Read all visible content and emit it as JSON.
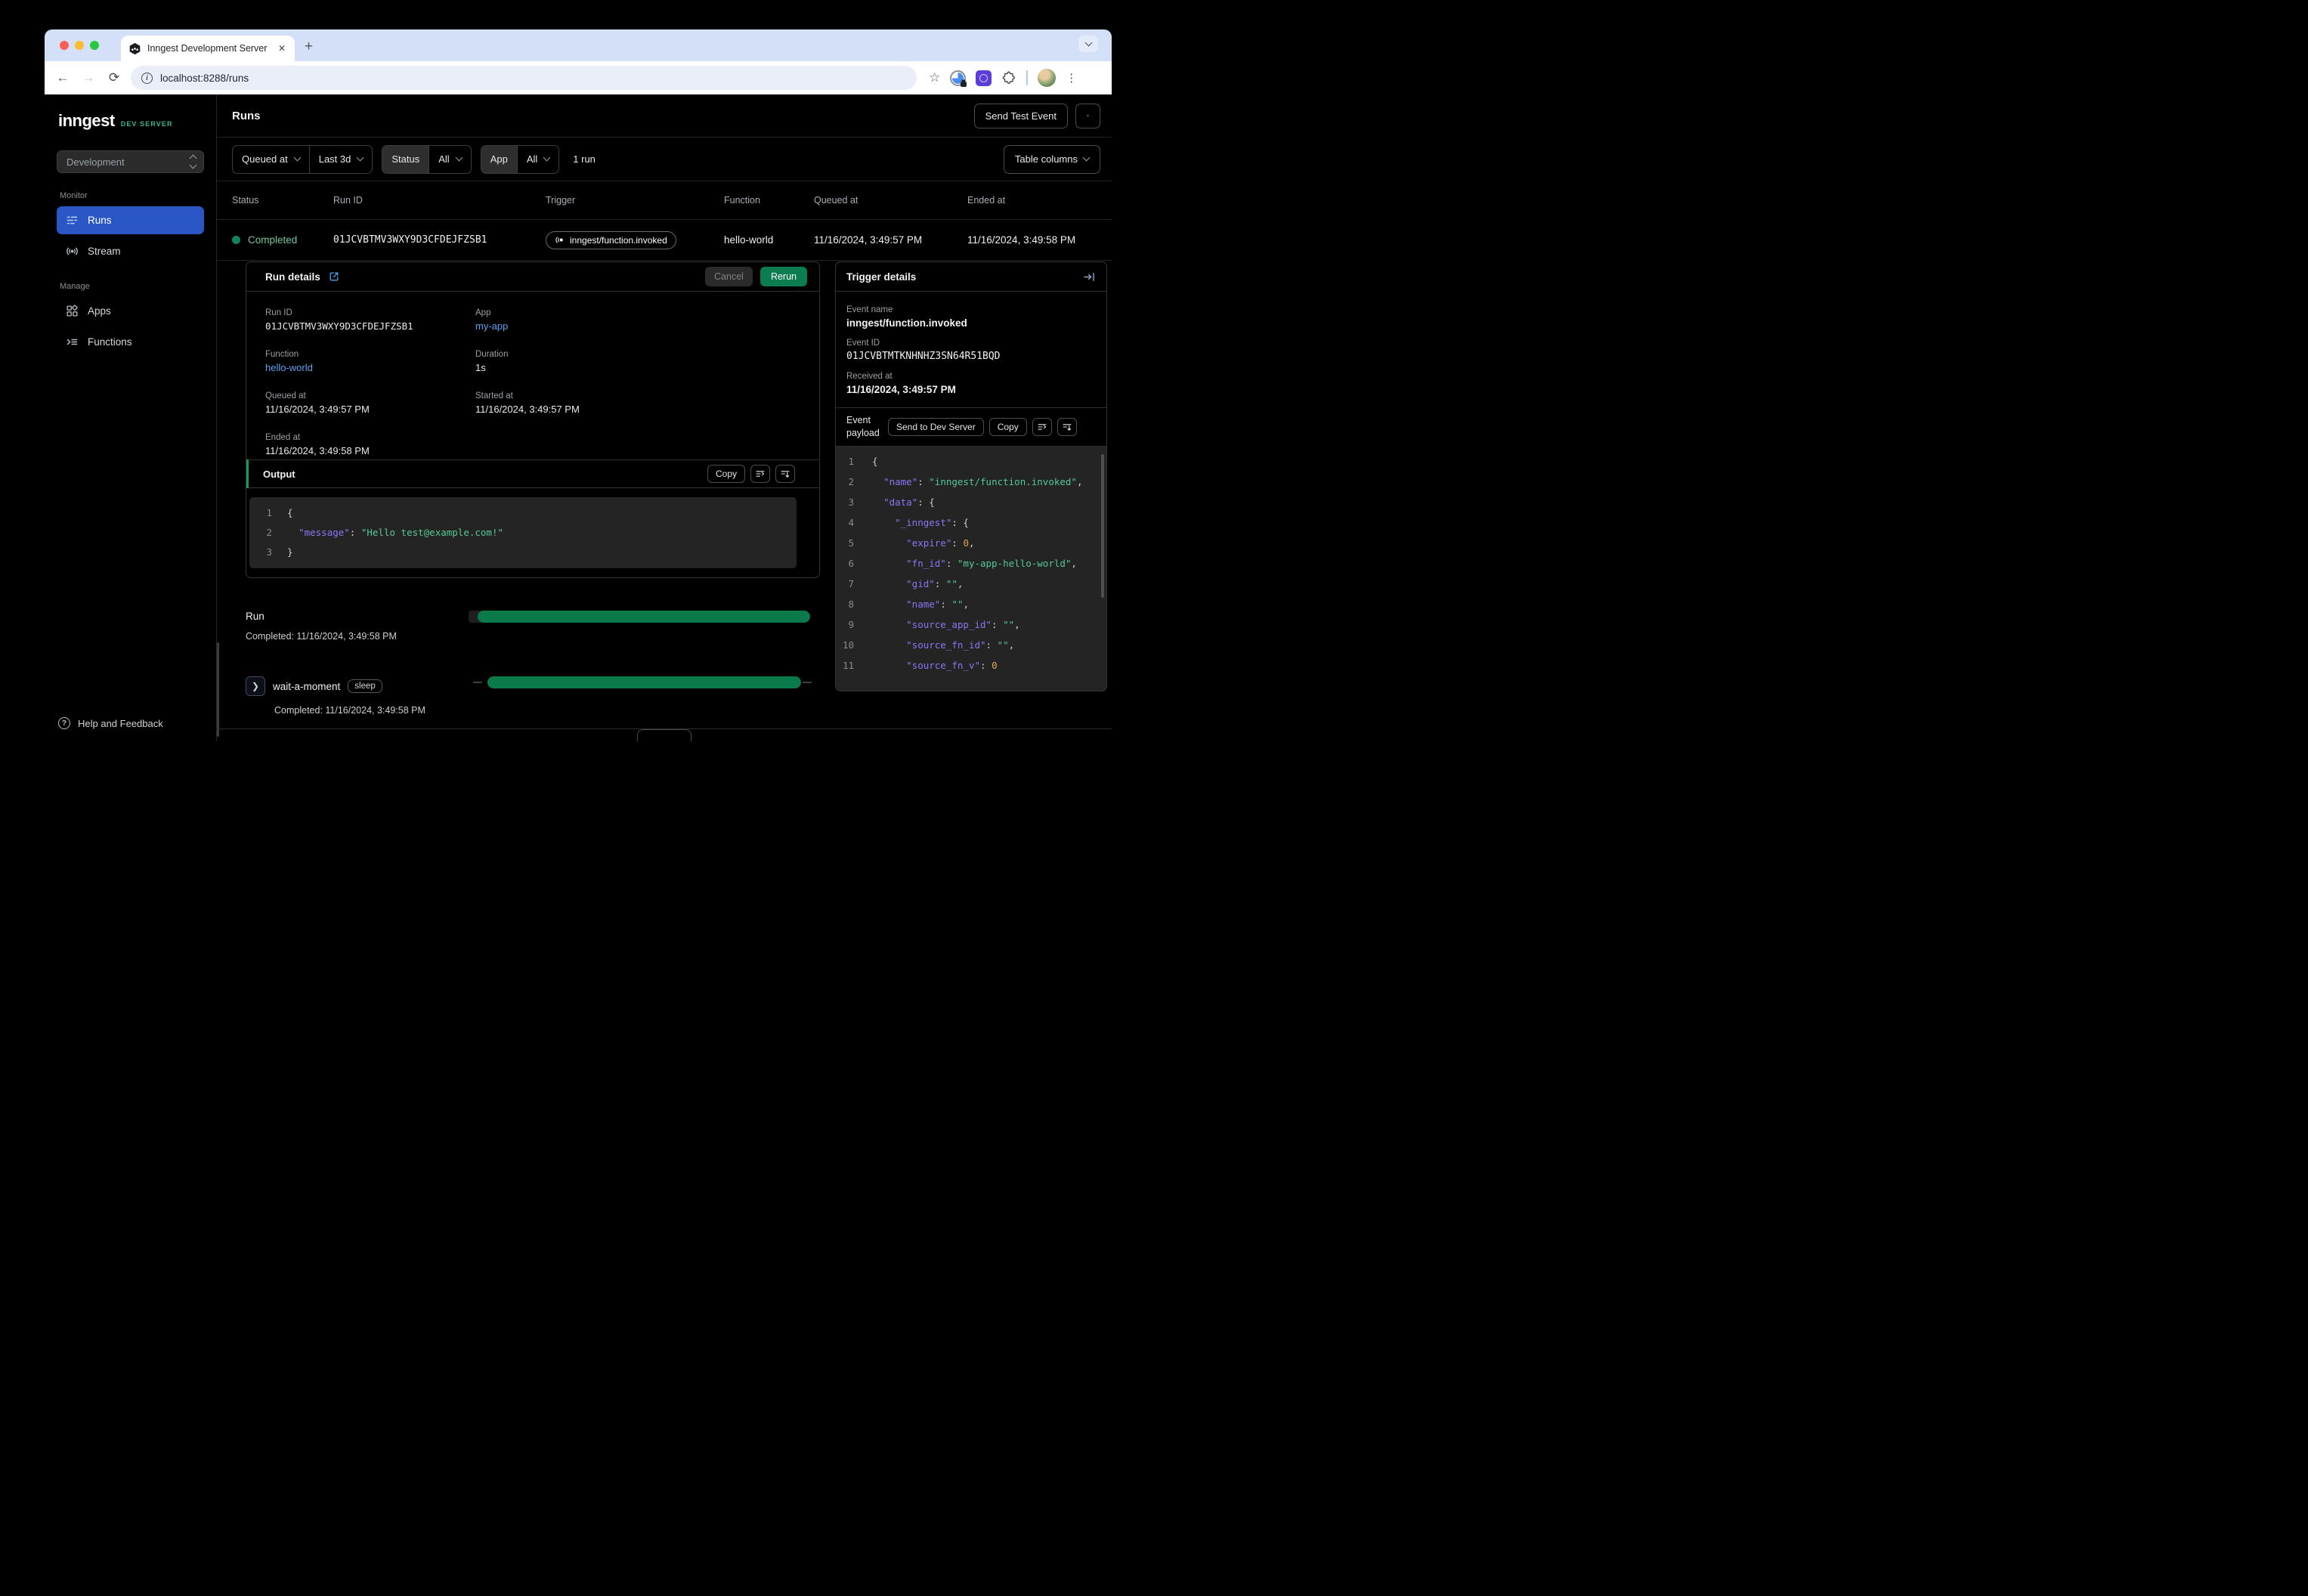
{
  "browser": {
    "tab_title": "Inngest Development Server",
    "url": "localhost:8288/runs"
  },
  "sidebar": {
    "logo": "inngest",
    "logo_badge": "DEV SERVER",
    "env_select": "Development",
    "sections": [
      {
        "label": "Monitor",
        "items": [
          {
            "label": "Runs"
          },
          {
            "label": "Stream"
          }
        ]
      },
      {
        "label": "Manage",
        "items": [
          {
            "label": "Apps"
          },
          {
            "label": "Functions"
          }
        ]
      }
    ],
    "help": "Help and Feedback"
  },
  "header": {
    "title": "Runs",
    "send_test_event": "Send Test Event"
  },
  "filters": {
    "time_field": "Queued at",
    "time_range": "Last 3d",
    "status_label": "Status",
    "status_value": "All",
    "app_label": "App",
    "app_value": "All",
    "run_count": "1 run",
    "table_columns": "Table columns"
  },
  "table": {
    "columns": [
      "Status",
      "Run ID",
      "Trigger",
      "Function",
      "Queued at",
      "Ended at"
    ],
    "row": {
      "status": "Completed",
      "run_id": "01JCVBTMV3WXY9D3CFDEJFZSB1",
      "trigger": "inngest/function.invoked",
      "function": "hello-world",
      "queued_at": "11/16/2024, 3:49:57 PM",
      "ended_at": "11/16/2024, 3:49:58 PM"
    }
  },
  "run_details": {
    "title": "Run details",
    "cancel": "Cancel",
    "rerun": "Rerun",
    "run_id_label": "Run ID",
    "run_id": "01JCVBTMV3WXY9D3CFDEJFZSB1",
    "app_label": "App",
    "app": "my-app",
    "function_label": "Function",
    "function": "hello-world",
    "duration_label": "Duration",
    "duration": "1s",
    "queued_label": "Queued at",
    "queued": "11/16/2024, 3:49:57 PM",
    "started_label": "Started at",
    "started": "11/16/2024, 3:49:57 PM",
    "ended_label": "Ended at",
    "ended": "11/16/2024, 3:49:58 PM",
    "output_title": "Output",
    "copy": "Copy"
  },
  "timeline": {
    "run_label": "Run",
    "run_completed": "Completed: 11/16/2024, 3:49:58 PM",
    "step_name": "wait-a-moment",
    "step_kind": "sleep",
    "step_completed": "Completed: 11/16/2024, 3:49:58 PM"
  },
  "trigger_details": {
    "title": "Trigger details",
    "event_name_label": "Event name",
    "event_name": "inngest/function.invoked",
    "event_id_label": "Event ID",
    "event_id": "01JCVBTMTKNHNHZ3SN64R51BQD",
    "received_label": "Received at",
    "received": "11/16/2024, 3:49:57 PM",
    "payload_label": "Event payload",
    "send_to_dev_server": "Send to Dev Server",
    "copy": "Copy"
  },
  "code": {
    "output": [
      {
        "n": "1",
        "t": [
          [
            "p",
            "{"
          ]
        ]
      },
      {
        "n": "2",
        "t": [
          [
            "p",
            "  "
          ],
          [
            "k",
            "\"message\""
          ],
          [
            "p",
            ": "
          ],
          [
            "s",
            "\"Hello test@example.com!\""
          ]
        ]
      },
      {
        "n": "3",
        "t": [
          [
            "p",
            "}"
          ]
        ]
      }
    ],
    "payload": [
      {
        "n": "1",
        "t": [
          [
            "p",
            "{"
          ]
        ]
      },
      {
        "n": "2",
        "t": [
          [
            "p",
            "  "
          ],
          [
            "k",
            "\"name\""
          ],
          [
            "p",
            ": "
          ],
          [
            "s",
            "\"inngest/function.invoked\""
          ],
          [
            "p",
            ","
          ]
        ]
      },
      {
        "n": "3",
        "t": [
          [
            "p",
            "  "
          ],
          [
            "k",
            "\"data\""
          ],
          [
            "p",
            ": {"
          ]
        ]
      },
      {
        "n": "4",
        "t": [
          [
            "p",
            "    "
          ],
          [
            "k",
            "\"_inngest\""
          ],
          [
            "p",
            ": {"
          ]
        ]
      },
      {
        "n": "5",
        "t": [
          [
            "p",
            "      "
          ],
          [
            "k",
            "\"expire\""
          ],
          [
            "p",
            ": "
          ],
          [
            "n2",
            "0"
          ],
          [
            "p",
            ","
          ]
        ]
      },
      {
        "n": "6",
        "t": [
          [
            "p",
            "      "
          ],
          [
            "k",
            "\"fn_id\""
          ],
          [
            "p",
            ": "
          ],
          [
            "s",
            "\"my-app-hello-world\""
          ],
          [
            "p",
            ","
          ]
        ]
      },
      {
        "n": "7",
        "t": [
          [
            "p",
            "      "
          ],
          [
            "k",
            "\"gid\""
          ],
          [
            "p",
            ": "
          ],
          [
            "s",
            "\"\""
          ],
          [
            "p",
            ","
          ]
        ]
      },
      {
        "n": "8",
        "t": [
          [
            "p",
            "      "
          ],
          [
            "k",
            "\"name\""
          ],
          [
            "p",
            ": "
          ],
          [
            "s",
            "\"\""
          ],
          [
            "p",
            ","
          ]
        ]
      },
      {
        "n": "9",
        "t": [
          [
            "p",
            "      "
          ],
          [
            "k",
            "\"source_app_id\""
          ],
          [
            "p",
            ": "
          ],
          [
            "s",
            "\"\""
          ],
          [
            "p",
            ","
          ]
        ]
      },
      {
        "n": "10",
        "t": [
          [
            "p",
            "      "
          ],
          [
            "k",
            "\"source_fn_id\""
          ],
          [
            "p",
            ": "
          ],
          [
            "s",
            "\"\""
          ],
          [
            "p",
            ","
          ]
        ]
      },
      {
        "n": "11",
        "t": [
          [
            "p",
            "      "
          ],
          [
            "k",
            "\"source_fn_v\""
          ],
          [
            "p",
            ": "
          ],
          [
            "n2",
            "0"
          ]
        ]
      }
    ]
  },
  "colors": {
    "active_nav_blue": "#2a56c6",
    "link_blue": "#5ba3f0",
    "status_green_text": "#72c79e",
    "status_green_dot": "#12835a",
    "bar_green": "#0b7a4b",
    "rerun_green": "#0c7d50",
    "dev_server_badge_green": "#3eb488",
    "output_accent_green": "#179a57",
    "code_background": "#242424",
    "json_key_purple": "#8b76f2",
    "json_string_green": "#56c894",
    "json_number_orange": "#e0a458"
  }
}
